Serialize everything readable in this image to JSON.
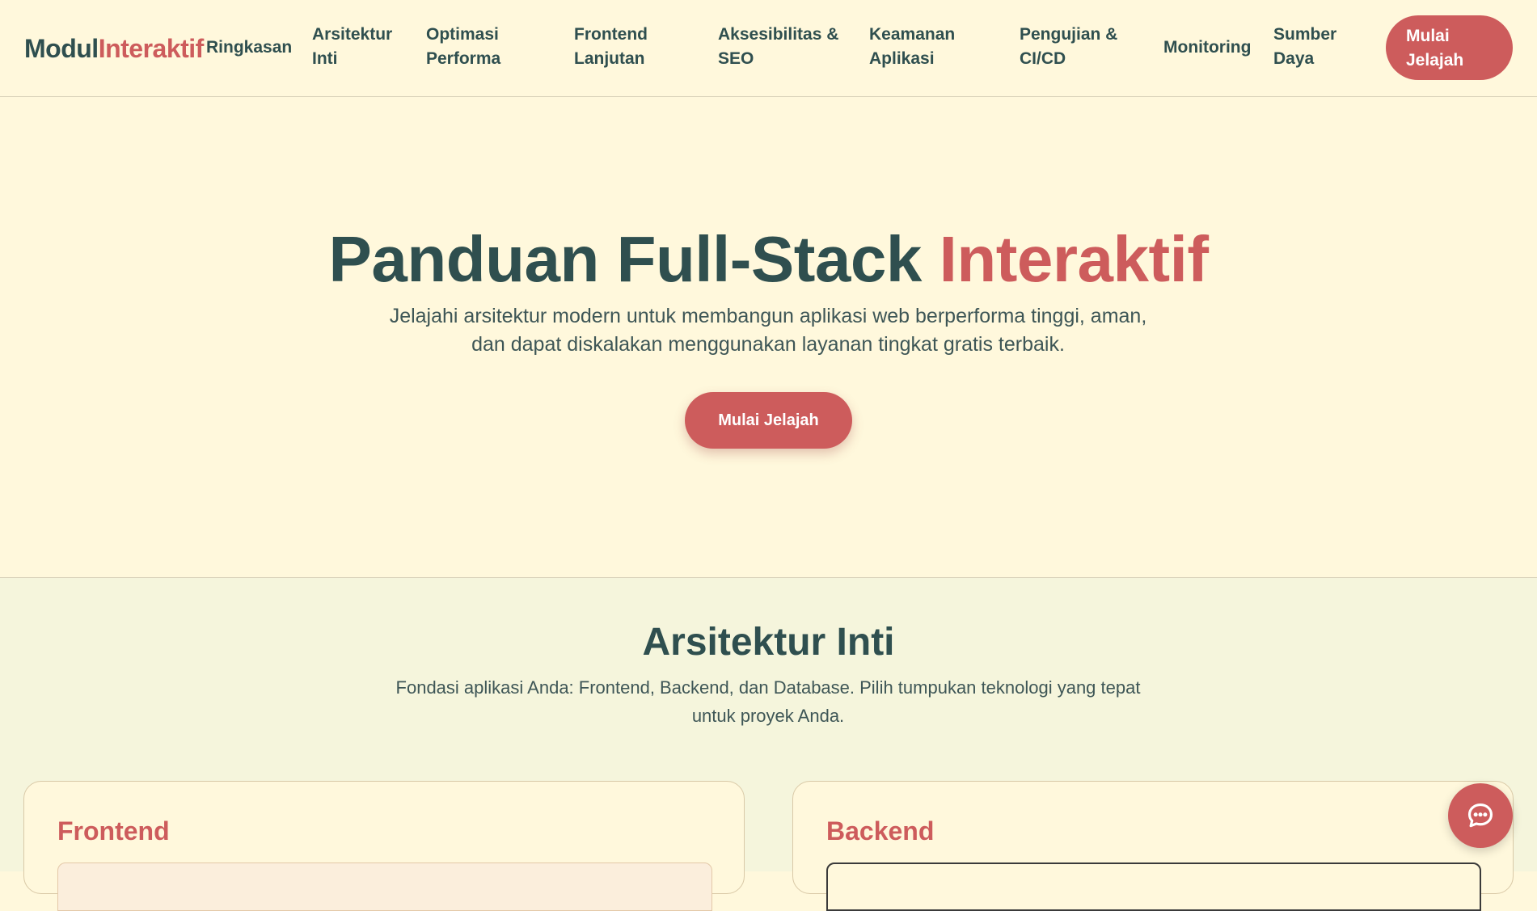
{
  "brand": {
    "part1": "Modul",
    "part2": "Interaktif"
  },
  "nav": {
    "items": [
      {
        "line1": "Ringkasan",
        "line2": ""
      },
      {
        "line1": "Arsitektur",
        "line2": "Inti"
      },
      {
        "line1": "Optimasi",
        "line2": "Performa"
      },
      {
        "line1": "Frontend",
        "line2": "Lanjutan"
      },
      {
        "line1": "Aksesibilitas &",
        "line2": "SEO"
      },
      {
        "line1": "Keamanan",
        "line2": "Aplikasi"
      },
      {
        "line1": "Pengujian &",
        "line2": "CI/CD"
      },
      {
        "line1": "Monitoring",
        "line2": ""
      },
      {
        "line1": "Sumber",
        "line2": "Daya"
      }
    ],
    "cta": {
      "line1": "Mulai",
      "line2": "Jelajah"
    }
  },
  "hero": {
    "title_part1": "Panduan Full-Stack ",
    "title_part2": "Interaktif",
    "subtitle": "Jelajahi arsitektur modern untuk membangun aplikasi web berperforma tinggi, aman, dan dapat diskalakan menggunakan layanan tingkat gratis terbaik.",
    "button": "Mulai Jelajah"
  },
  "section": {
    "title": "Arsitektur Inti",
    "subtitle": "Fondasi aplikasi Anda: Frontend, Backend, dan Database. Pilih tumpukan teknologi yang tepat untuk proyek Anda.",
    "cards": [
      {
        "title": "Frontend"
      },
      {
        "title": "Backend"
      }
    ]
  },
  "chat": {
    "icon": "chat-bubble-icon"
  },
  "colors": {
    "background": "#FFF8DC",
    "section_background": "#F5F5DC",
    "primary_text": "#2F4F4F",
    "accent": "#CD5C5C"
  }
}
